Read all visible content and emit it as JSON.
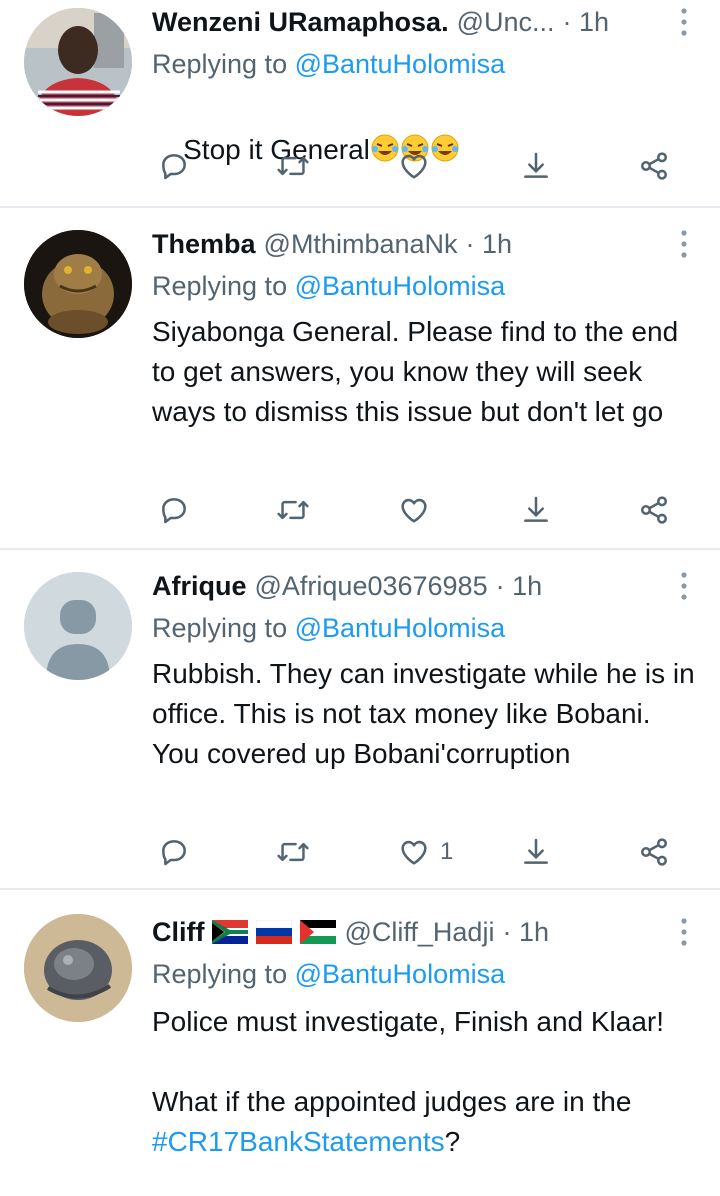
{
  "tweets": [
    {
      "name": "Wenzeni URamaphosa.",
      "handle": "@Unc...",
      "time": "· 1h",
      "replying_prefix": "Replying to ",
      "replying_to": "@BantuHolomisa",
      "text": "Stop it General",
      "emojis": [
        "rolling-on-floor-laughing",
        "rolling-on-floor-laughing",
        "rolling-on-floor-laughing"
      ],
      "likes": ""
    },
    {
      "name": "Themba",
      "handle": "@MthimbanaNk",
      "time": "· 1h",
      "replying_prefix": "Replying to ",
      "replying_to": "@BantuHolomisa",
      "text": "Siyabonga General. Please find to the end to get answers, you know they will seek ways to dismiss this issue but don't let go",
      "likes": ""
    },
    {
      "name": "Afrique",
      "handle": "@Afrique03676985",
      "time": "· 1h",
      "replying_prefix": "Replying to ",
      "replying_to": "@BantuHolomisa",
      "text": "Rubbish. They can investigate while he is in office. This is not tax money like Bobani. You covered up Bobani'corruption",
      "likes": "1"
    },
    {
      "name": "Cliff",
      "handle": "@Cliff_Hadji",
      "time": "· 1h",
      "flags": [
        "south-africa-flag",
        "russia-flag",
        "palestine-flag"
      ],
      "replying_prefix": "Replying to ",
      "replying_to": "@BantuHolomisa",
      "text": "Police must investigate, Finish and Klaar!\n\nWhat if the appointed judges are in the ",
      "hashtag": "#CR17BankStatements",
      "text_end": "?"
    }
  ],
  "icons": {
    "reply": "reply-icon",
    "retweet": "retweet-icon",
    "like": "heart-icon",
    "bookmark": "download-icon",
    "share": "share-icon",
    "more": "more-vertical-icon"
  },
  "colors": {
    "link": "#1d9bf0",
    "secondary_text": "#536471",
    "divider": "#e6ecf0"
  }
}
